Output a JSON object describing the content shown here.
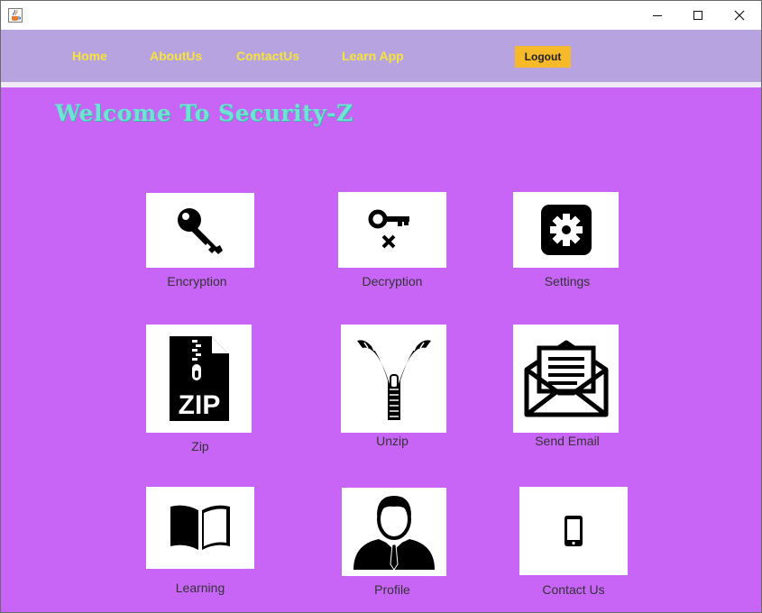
{
  "window": {
    "app_icon": "java-cup-icon",
    "controls": [
      "minimize-icon",
      "maximize-icon",
      "close-icon"
    ]
  },
  "menu": {
    "home": "Home",
    "about": "AboutUs",
    "contact": "ContactUs",
    "learn": "Learn App",
    "logout": "Logout"
  },
  "welcome": "Welcome To Security-Z",
  "colors": {
    "background": "#c865f7",
    "menubar": "#b7a3e0",
    "menu_text": "#f7e43a",
    "logout_button": "#f6b929",
    "welcome_text": "#6fe3d4"
  },
  "tiles": {
    "encryption": {
      "label": "Encryption",
      "icon": "key-icon"
    },
    "decryption": {
      "label": "Decryption",
      "icon": "key-cross-icon"
    },
    "settings": {
      "label": "Settings",
      "icon": "gear-icon"
    },
    "zip": {
      "label": "Zip",
      "icon": "zip-file-icon"
    },
    "unzip": {
      "label": "Unzip",
      "icon": "zipper-icon"
    },
    "email": {
      "label": "Send Email",
      "icon": "envelope-icon"
    },
    "learning": {
      "label": "Learning",
      "icon": "book-icon"
    },
    "profile": {
      "label": "Profile",
      "icon": "user-icon"
    },
    "contact": {
      "label": "Contact Us",
      "icon": "phone-icon"
    }
  }
}
